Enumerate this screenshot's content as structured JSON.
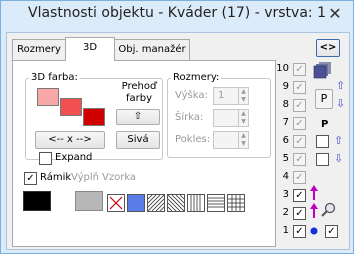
{
  "window": {
    "title": "Vlastnosti objektu - Kváder (17) - vrstva: 1",
    "close_glyph": "✕"
  },
  "tabs": [
    {
      "label": "Rozmery"
    },
    {
      "label": "3D"
    },
    {
      "label": "Obj. manažér"
    }
  ],
  "tab3d": {
    "color_legend": "3D farba:",
    "transfer_label": "Prehoď farby",
    "up_arrow": "⇧",
    "gray_button": "Sivá",
    "swap_button": "<-- x -->",
    "expand_label": "Expand",
    "colors": {
      "light": "#f8a8a8",
      "mid": "#f05050",
      "dark": "#d00000"
    }
  },
  "dims": {
    "legend": "Rozmery:",
    "height_label": "Výška:",
    "height_value": "1",
    "width_label": "Šírka:",
    "decline_label": "Pokles:"
  },
  "frame": {
    "label": "Rámik",
    "fill_label": "Výplň",
    "pattern_label": "Vzorka"
  },
  "right": {
    "toggle_button": "<>",
    "p_label": "P",
    "p_button": "P"
  },
  "layers": [
    {
      "num": "10",
      "state": "gray"
    },
    {
      "num": "9",
      "state": "gray"
    },
    {
      "num": "8",
      "state": "gray"
    },
    {
      "num": "7",
      "state": "gray"
    },
    {
      "num": "6",
      "state": "gray"
    },
    {
      "num": "5",
      "state": "gray"
    },
    {
      "num": "4",
      "state": "gray"
    },
    {
      "num": "3",
      "state": "checked"
    },
    {
      "num": "2",
      "state": "checked"
    },
    {
      "num": "1",
      "state": "checked"
    }
  ]
}
